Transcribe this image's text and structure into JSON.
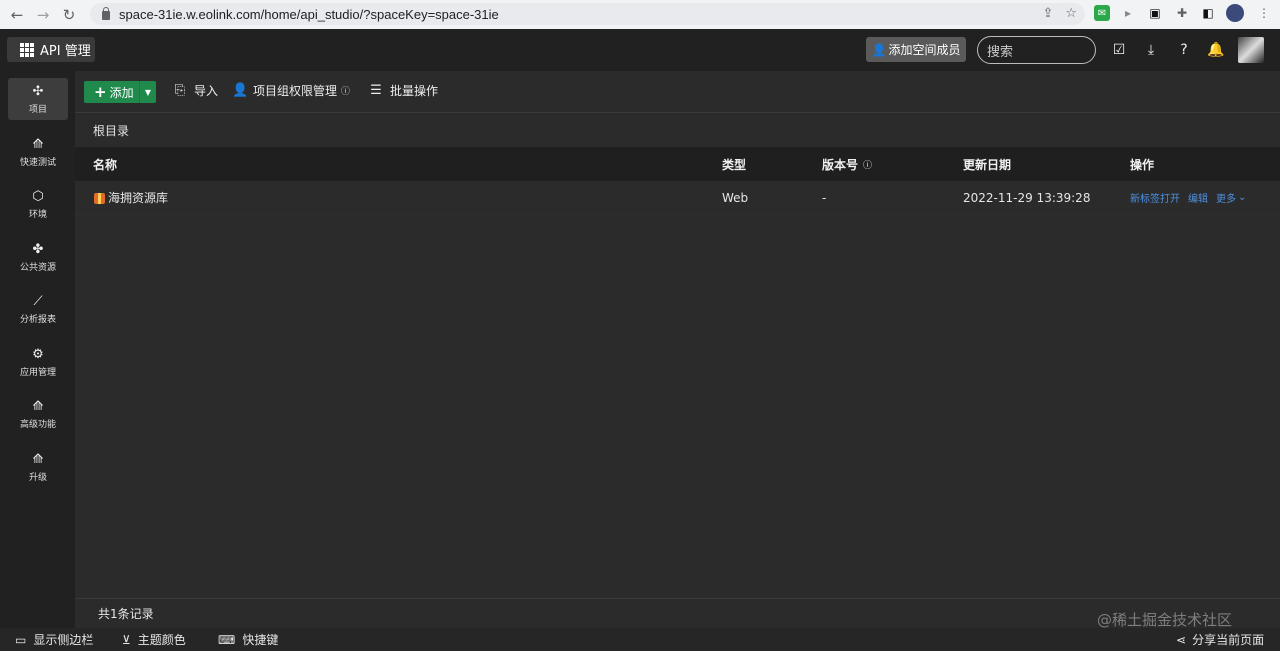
{
  "browser": {
    "url": "space-31ie.w.eolink.com/home/api_studio/?spaceKey=space-31ie"
  },
  "header": {
    "app_label": "API 管理",
    "invite_label": "添加空间成员",
    "search_placeholder": "搜索"
  },
  "sidebar": {
    "items": [
      {
        "label": "项目",
        "icon": "project-icon"
      },
      {
        "label": "快速测试",
        "icon": "rocket-icon"
      },
      {
        "label": "环境",
        "icon": "cube-icon"
      },
      {
        "label": "公共资源",
        "icon": "puzzle-icon"
      },
      {
        "label": "分析报表",
        "icon": "chart-icon"
      },
      {
        "label": "应用管理",
        "icon": "gear-icon"
      },
      {
        "label": "高级功能",
        "icon": "rocket-icon"
      },
      {
        "label": "升级",
        "icon": "rocket-icon"
      }
    ]
  },
  "toolbar": {
    "add_label": "添加",
    "import_label": "导入",
    "permission_label": "项目组权限管理",
    "batch_label": "批量操作"
  },
  "breadcrumb": "根目录",
  "table": {
    "columns": [
      "名称",
      "类型",
      "版本号",
      "更新日期",
      "操作"
    ],
    "rows": [
      {
        "name": "海拥资源库",
        "type": "Web",
        "version": "-",
        "updated": "2022-11-29 13:39:28",
        "actions": [
          "新标签打开",
          "编辑",
          "更多"
        ]
      }
    ]
  },
  "footer": {
    "record_count": "共1条记录"
  },
  "bottom_bar": {
    "show_sidebar": "显示侧边栏",
    "theme_color": "主题颜色",
    "shortcuts": "快捷键",
    "share": "分享当前页面"
  },
  "watermark": "@稀土掘金技术社区",
  "colors": {
    "accent_green": "#1f8a4c",
    "link_blue": "#4f8fe0",
    "background": "#2b2b2b"
  }
}
